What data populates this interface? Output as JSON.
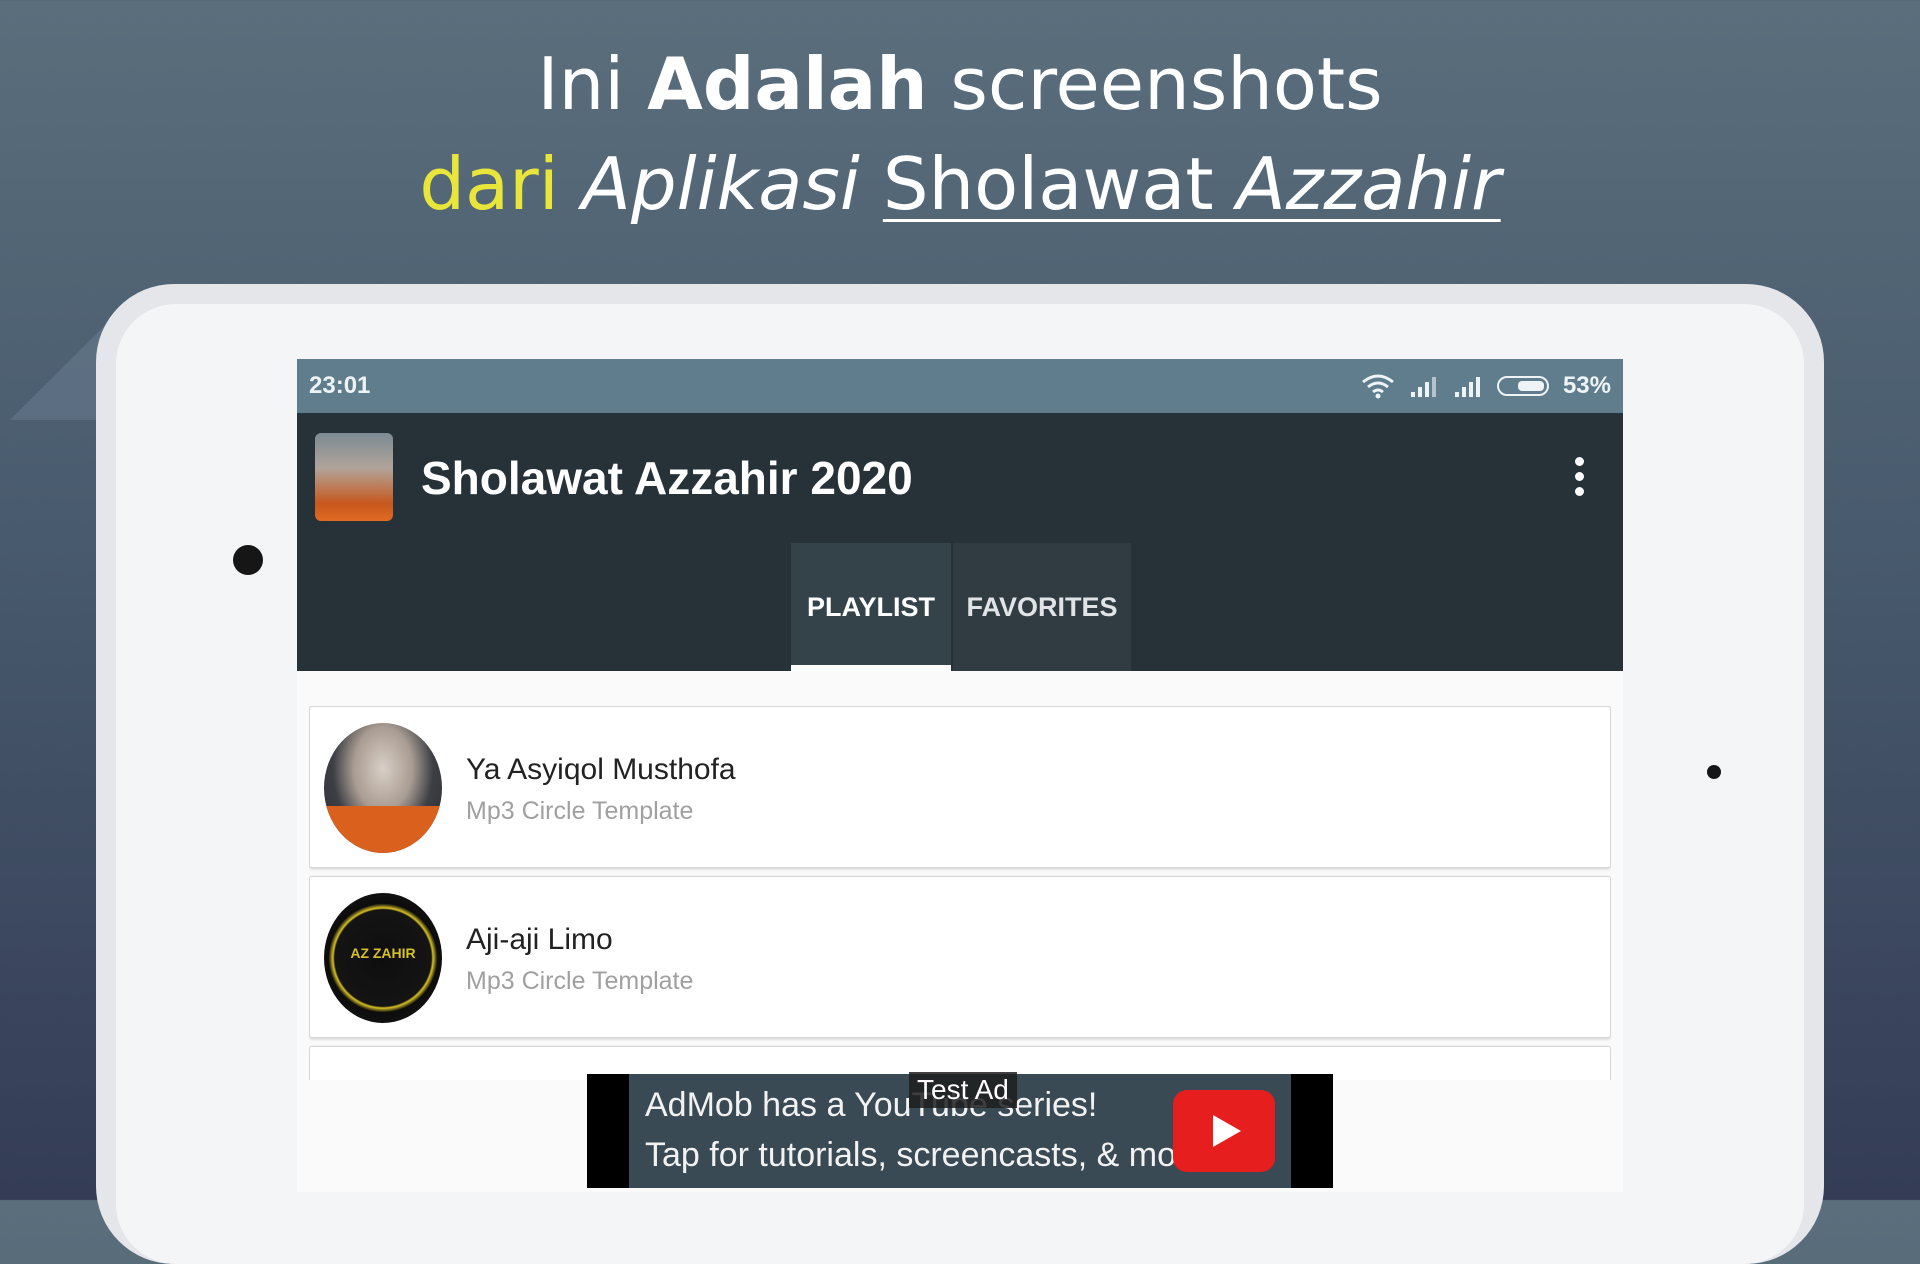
{
  "banner": {
    "line1_pre": "Ini ",
    "line1_bold": "Adalah",
    "line1_post": " screenshots",
    "line2_yellow": "dari",
    "line2_italic": "Aplikasi",
    "line2_underline_plain": "Sholawat ",
    "line2_underline_italic": "Azzahir"
  },
  "status_bar": {
    "time": "23:01",
    "battery": "53%",
    "icons": [
      "wifi-icon",
      "signal-icon",
      "signal-icon",
      "battery-icon"
    ]
  },
  "app_bar": {
    "title": "Sholawat Azzahir 2020",
    "menu_icon": "more-vert-icon"
  },
  "tabs": [
    {
      "label": "PLAYLIST",
      "selected": true
    },
    {
      "label": "FAVORITES",
      "selected": false
    }
  ],
  "playlist": [
    {
      "title": "Ya Asyiqol Musthofa",
      "subtitle": "Mp3 Circle Template"
    },
    {
      "title": "Aji-aji Limo",
      "subtitle": "Mp3 Circle Template"
    }
  ],
  "seal_logo_text": "AZ ZAHIR",
  "ad": {
    "badge": "Test Ad",
    "line1": "AdMob has a YouTube series!",
    "line2": "Tap for tutorials, screencasts, & more.",
    "icon": "youtube-play-icon"
  },
  "colors": {
    "status_bar": "#5f7d8c",
    "app_bar": "#263238",
    "accent_yellow": "#e8e63a"
  }
}
